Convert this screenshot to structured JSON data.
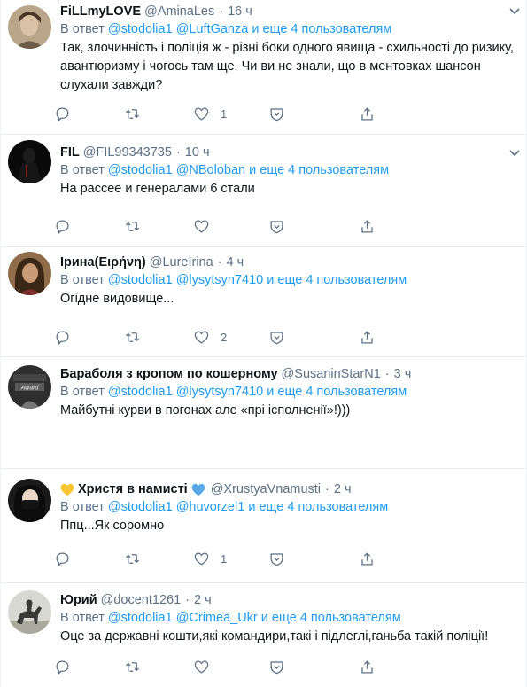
{
  "common": {
    "reply_prefix": "В ответ",
    "reply_suffix": "и еще 4 пользователям",
    "mention_root": "@stodolia1"
  },
  "tweets": [
    {
      "name": "FiLLmyLOVE",
      "handle": "@AminaLes",
      "time": "16 ч",
      "mention2": "@LuftGanza",
      "text": "Так, злочинність і поліція ж - різні боки одного явища - схильності до ризику, авантюризму і чогось там ще. Чи ви не знали, що в ментовках шансон слухали завжди?",
      "likes": "1",
      "avatar_icon": "portrait-avatar"
    },
    {
      "name": "FIL",
      "handle": "@FIL99343735",
      "time": "10 ч",
      "mention2": "@NBoloban",
      "text": "На рассее и генералами 6 стали",
      "likes": "",
      "avatar_icon": "dark-figure-avatar"
    },
    {
      "name": "Ірина(Ειρήνη)",
      "handle": "@LureIrina",
      "time": "4 ч",
      "mention2": "@lysytsyn7410",
      "text": "Огідне видовище...",
      "likes": "2",
      "avatar_icon": "woman-avatar"
    },
    {
      "name": "Бараболя з кропом по кошерному",
      "handle": "@SusaninStarN1",
      "time": "3 ч",
      "mention2": "@lysytsyn7410",
      "text": "Майбутні курви в погонах але «прі ісполненії»!)))",
      "likes": "",
      "avatar_icon": "award-avatar"
    },
    {
      "name": "Христя в намисті",
      "handle": "@XrustyaVnamusti",
      "time": "2 ч",
      "mention2": "@huvorzel1",
      "text": "Ппц...Як соромно",
      "likes": "1",
      "avatar_icon": "masked-face-avatar"
    },
    {
      "name": "Юрий",
      "handle": "@docent1261",
      "time": "2 ч",
      "mention2": "@Crimea_Ukr",
      "text": "Оце за державні кошти,які командири,такі і підлеглі,ганьба такій поліції!",
      "likes": "",
      "avatar_icon": "horse-rider-avatar"
    }
  ],
  "colors": {
    "link": "#1d9bf0",
    "secondary": "#5b7083",
    "divider": "#e6ecf0",
    "heart_yellow": "#f7c631",
    "heart_blue": "#5aa9e6"
  }
}
